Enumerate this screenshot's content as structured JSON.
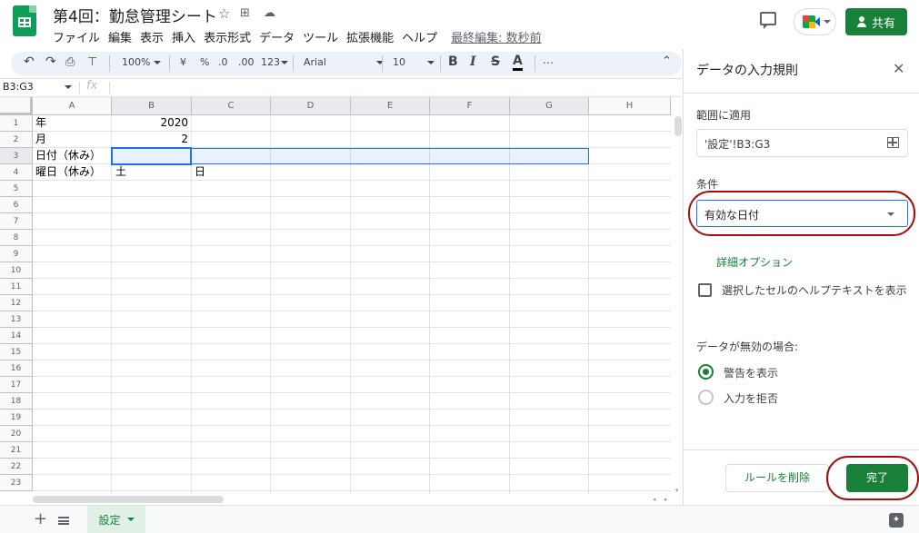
{
  "app": {
    "doc_title": "第4回：勤怠管理シート",
    "last_edit": "最終編集: 数秒前",
    "share_label": "共有",
    "colors": {
      "brand": "#0f9d58",
      "accent": "#188038",
      "selection": "#1a73e8",
      "annotation": "#a50e0e"
    }
  },
  "menu": [
    "ファイル",
    "編集",
    "表示",
    "挿入",
    "表示形式",
    "データ",
    "ツール",
    "拡張機能",
    "ヘルプ"
  ],
  "toolbar": {
    "zoom": "100%",
    "currency": "¥",
    "percent": "%",
    "decimal_decrease": ".0",
    "decimal_increase": ".00",
    "more_formats": "123",
    "font": "Arial",
    "font_size": "10",
    "bold": "B",
    "italic": "I",
    "strike": "S",
    "text_color": "A",
    "more": "⋯"
  },
  "formula_bar": {
    "name_box": "B3:G3",
    "fx": "fx"
  },
  "grid": {
    "columns": [
      "A",
      "B",
      "C",
      "D",
      "E",
      "F",
      "G",
      "H"
    ],
    "rows": [
      "1",
      "2",
      "3",
      "4",
      "5",
      "6",
      "7",
      "8",
      "9",
      "10",
      "11",
      "12",
      "13",
      "14",
      "15",
      "16",
      "17",
      "18",
      "19",
      "20",
      "21",
      "22",
      "23"
    ],
    "cells": {
      "a1": "年",
      "b1": "2020",
      "a2": "月",
      "b2": "2",
      "a3": "日付（休み）",
      "a4": "曜日（休み）",
      "b4": "土",
      "c4": "日"
    }
  },
  "sheet_tab": {
    "label": "設定"
  },
  "panel": {
    "title": "データの入力規則",
    "range_label": "範囲に適用",
    "range_value": "'設定'!B3:G3",
    "condition_label": "条件",
    "condition_value": "有効な日付",
    "advanced_options": "詳細オプション",
    "help_text_label": "選択したセルのヘルプテキストを表示",
    "help_text_checked": false,
    "invalid_label": "データが無効の場合:",
    "options": [
      {
        "label": "警告を表示",
        "selected": true
      },
      {
        "label": "入力を拒否",
        "selected": false
      }
    ],
    "remove_rule": "ルールを削除",
    "done": "完了"
  }
}
